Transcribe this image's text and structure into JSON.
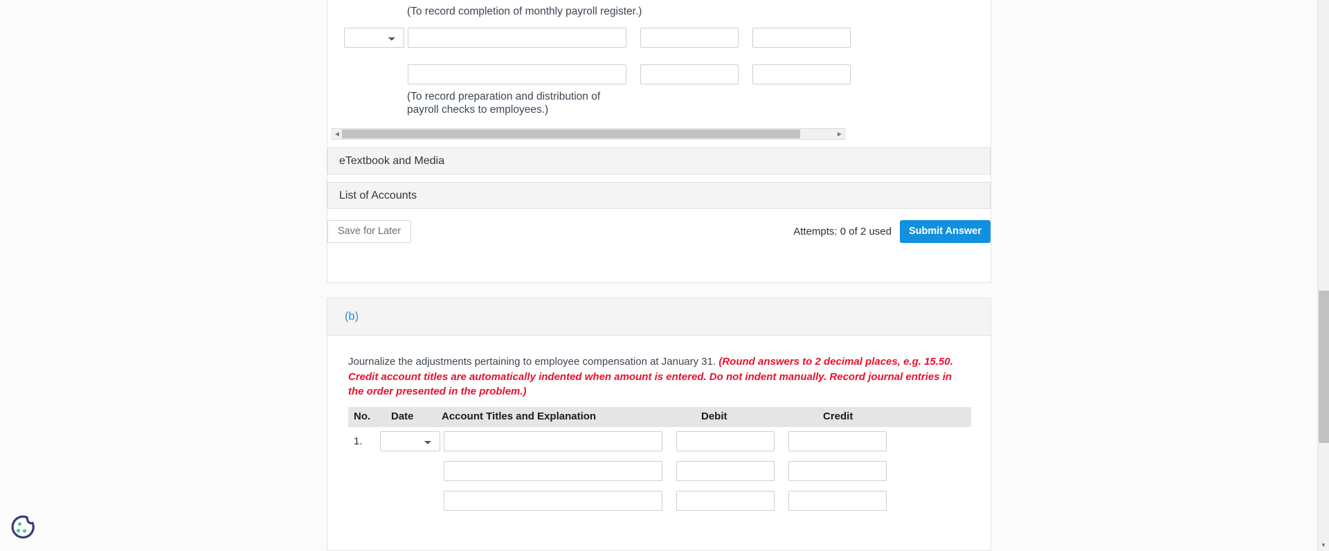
{
  "part_a": {
    "memo_1": "(To record completion of monthly payroll register.)",
    "memo_2": "(To record preparation and distribution of payroll checks to employees.)",
    "date_select_value": "",
    "rows": [
      {
        "account": "",
        "debit": "",
        "credit": ""
      },
      {
        "account": "",
        "debit": "",
        "credit": ""
      }
    ],
    "etextbook_bar": "eTextbook and Media",
    "list_of_accounts_bar": "List of Accounts",
    "save_for_later": "Save for Later",
    "attempts": "Attempts: 0 of 2 used",
    "submit_answer": "Submit Answer"
  },
  "part_b": {
    "label": "(b)",
    "prompt_plain": "Journalize the adjustments pertaining to employee compensation at January 31. ",
    "prompt_red": "(Round answers to 2 decimal places, e.g. 15.50. Credit account titles are automatically indented when amount is entered. Do not indent manually. Record journal entries in the order presented in the problem.)",
    "table": {
      "headers": [
        "No.",
        "Date",
        "Account Titles and Explanation",
        "Debit",
        "Credit"
      ],
      "rows": [
        {
          "no": "1.",
          "date_select_value": "",
          "account": "",
          "debit": "",
          "credit": ""
        },
        {
          "no": "",
          "date_select_value": "",
          "account": "",
          "debit": "",
          "credit": ""
        },
        {
          "no": "",
          "date_select_value": "",
          "account": "",
          "debit": "",
          "credit": ""
        }
      ]
    }
  },
  "scrollbars": {
    "h_left_arrow": "◀",
    "h_right_arrow": "▶",
    "v_down_arrow": "▼"
  },
  "colors": {
    "submit_blue": "#1190e0",
    "section_label_blue": "#2e8fd8",
    "prompt_red": "#e8112d",
    "cookie_outline": "#3c3c78",
    "cookie_dots": "#3ecf9a"
  }
}
